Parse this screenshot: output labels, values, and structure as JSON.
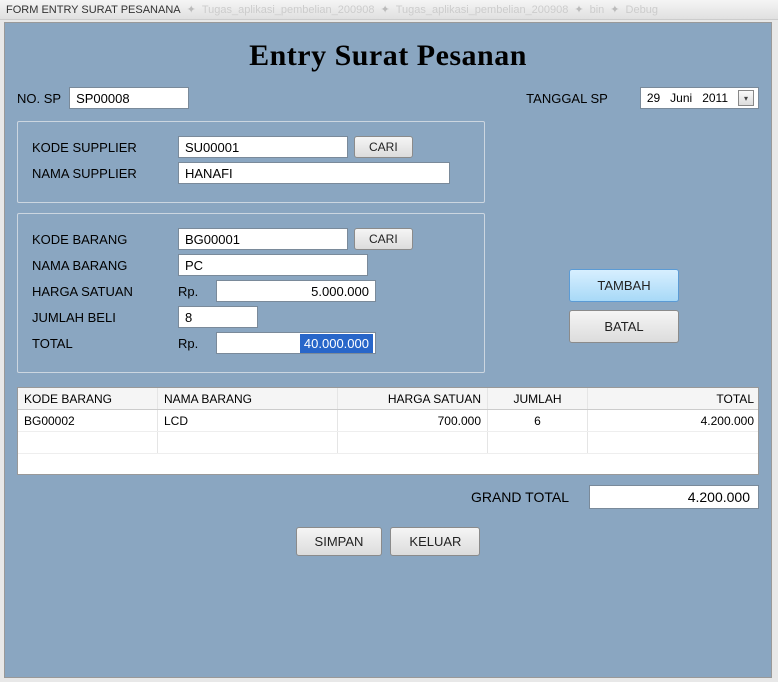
{
  "window": {
    "title": "FORM ENTRY SURAT PESANANA",
    "tabs": [
      "Tugas_aplikasi_pembelian_200908",
      "Tugas_aplikasi_pembelian_200908",
      "bin",
      "Debug"
    ]
  },
  "app_title": "Entry Surat Pesanan",
  "header": {
    "no_sp_label": "NO. SP",
    "no_sp_value": "SP00008",
    "tanggal_label": "TANGGAL SP",
    "tanggal_day": "29",
    "tanggal_month": "Juni",
    "tanggal_year": "2011"
  },
  "supplier": {
    "kode_label": "KODE SUPPLIER",
    "kode_value": "SU00001",
    "cari_label": "CARI",
    "nama_label": "NAMA SUPPLIER",
    "nama_value": "HANAFI"
  },
  "barang": {
    "kode_label": "KODE BARANG",
    "kode_value": "BG00001",
    "cari_label": "CARI",
    "nama_label": "NAMA BARANG",
    "nama_value": "PC",
    "harga_label": "HARGA SATUAN",
    "rp": "Rp.",
    "harga_value": "5.000.000",
    "jumlah_label": "JUMLAH BELI",
    "jumlah_value": "8",
    "total_label": "TOTAL",
    "total_value": "40.000.000"
  },
  "side": {
    "tambah": "TAMBAH",
    "batal": "BATAL"
  },
  "table": {
    "headers": {
      "kode": "KODE BARANG",
      "nama": "NAMA BARANG",
      "harga": "HARGA SATUAN",
      "jumlah": "JUMLAH",
      "total": "TOTAL"
    },
    "rows": [
      {
        "kode": "BG00002",
        "nama": "LCD",
        "harga": "700.000",
        "jumlah": "6",
        "total": "4.200.000"
      }
    ]
  },
  "footer": {
    "grand_label": "GRAND TOTAL",
    "grand_value": "4.200.000",
    "simpan": "SIMPAN",
    "keluar": "KELUAR"
  }
}
